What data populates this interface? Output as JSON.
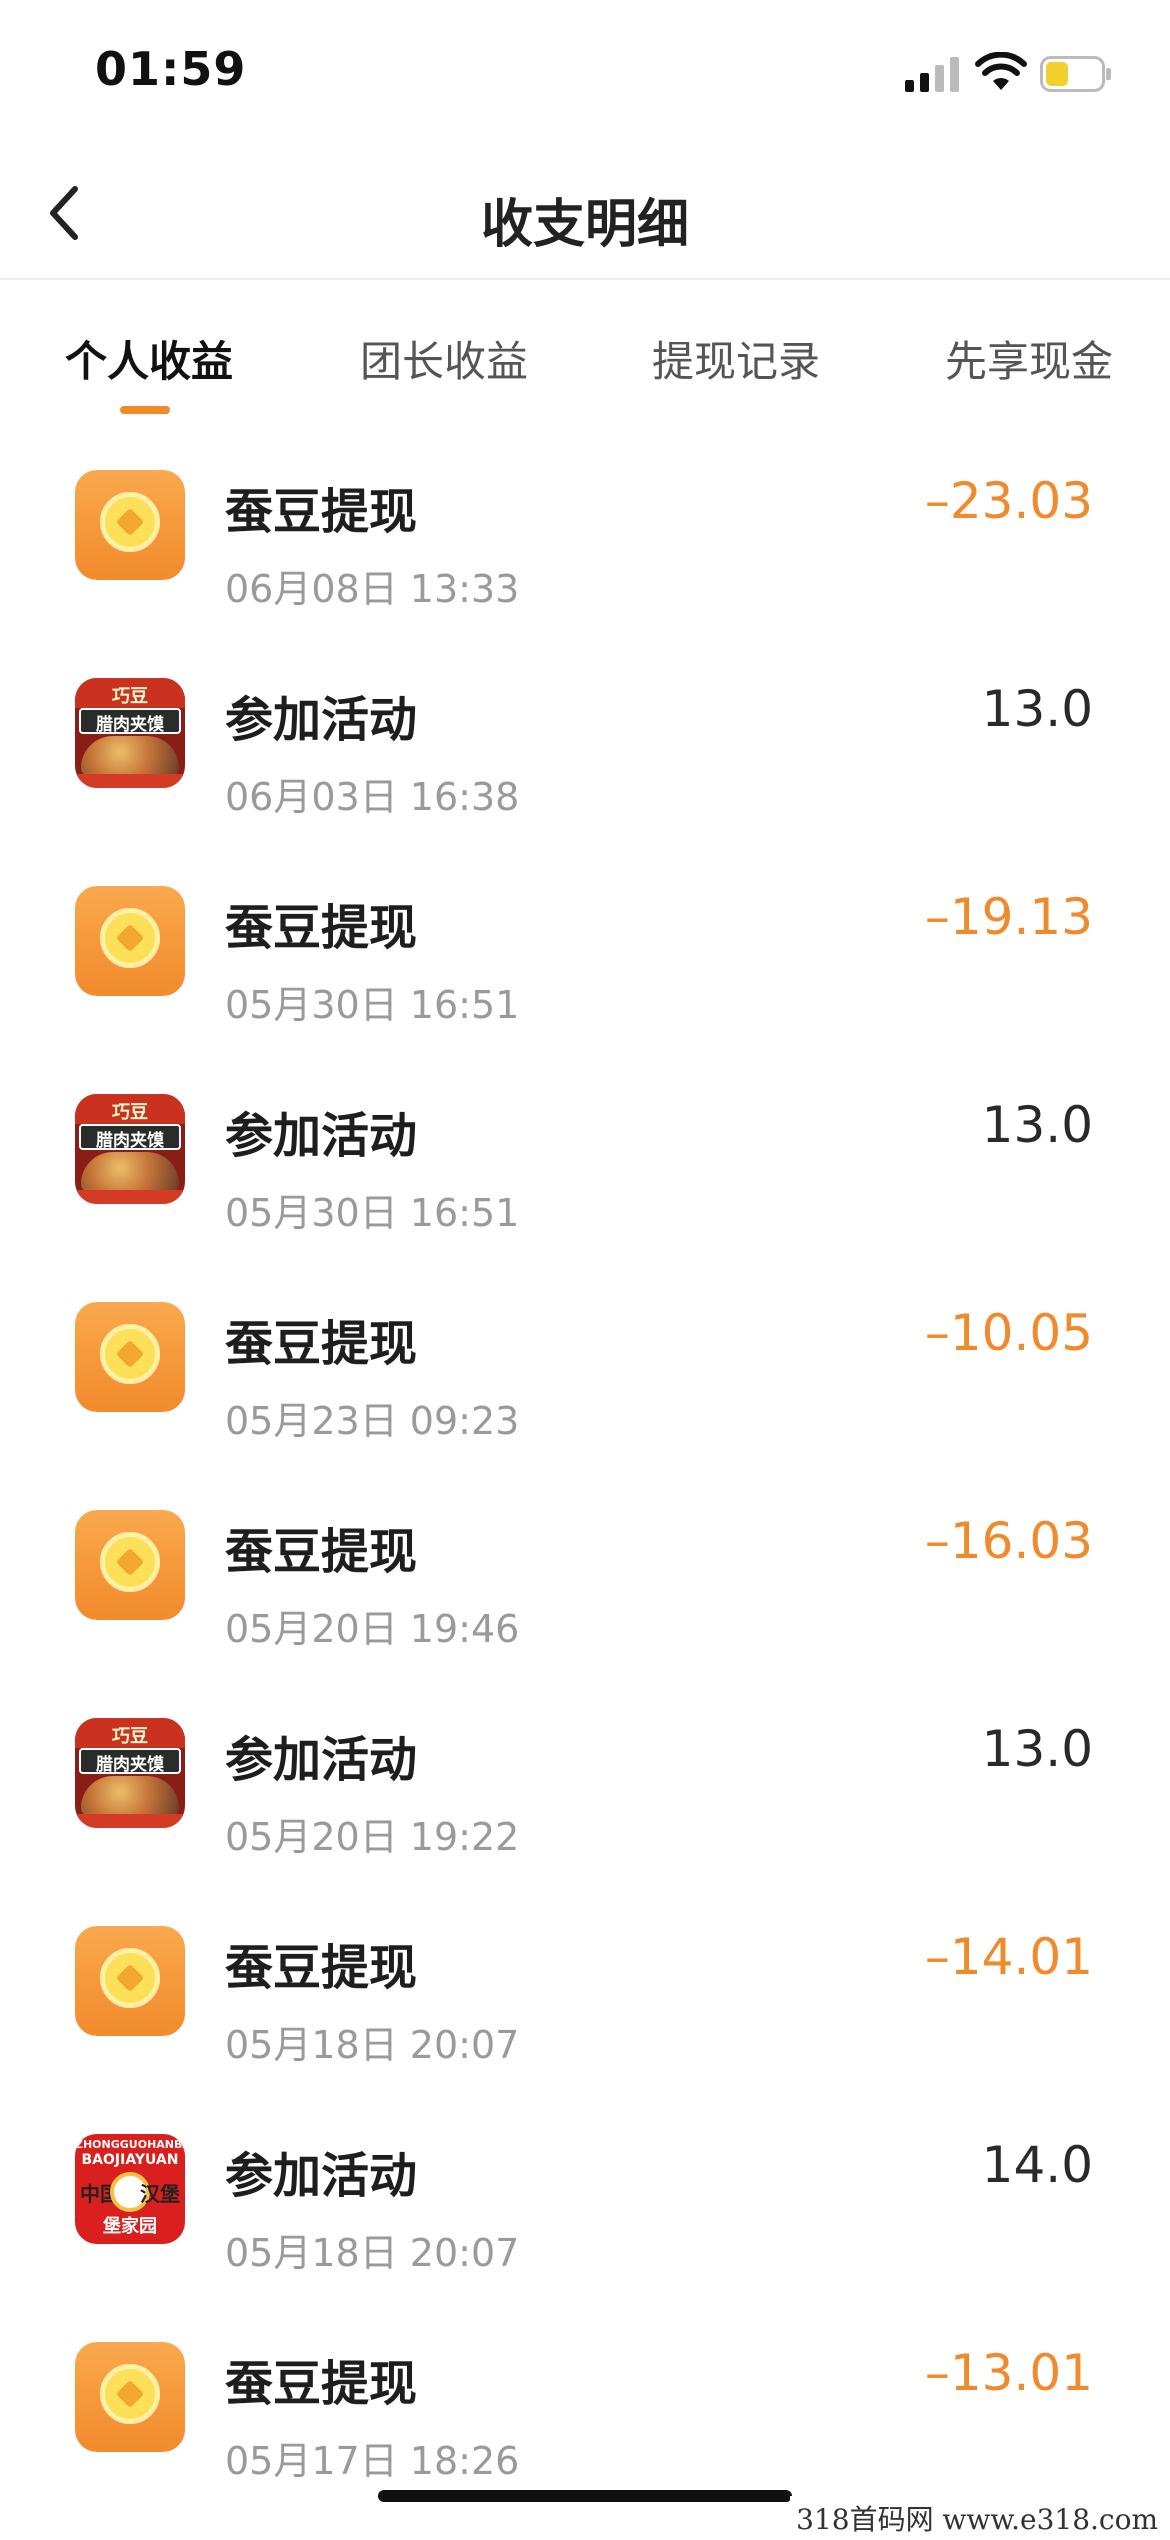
{
  "status_bar": {
    "time": "01:59"
  },
  "nav": {
    "title": "收支明细"
  },
  "tabs": [
    {
      "label": "个人收益",
      "active": true
    },
    {
      "label": "团长收益",
      "active": false
    },
    {
      "label": "提现记录",
      "active": false
    },
    {
      "label": "先享现金",
      "active": false
    }
  ],
  "colors": {
    "accent": "#f08a2a",
    "negative_amount": "#f08a2a",
    "positive_amount": "#2a2a2a"
  },
  "records": [
    {
      "icon": "coin-icon",
      "title": "蚕豆提现",
      "time": "06月08日 13:33",
      "amount": "–23.03",
      "negative": true
    },
    {
      "icon": "food-shop-icon",
      "title": "参加活动",
      "time": "06月03日 16:38",
      "amount": "13.0",
      "negative": false
    },
    {
      "icon": "coin-icon",
      "title": "蚕豆提现",
      "time": "05月30日 16:51",
      "amount": "–19.13",
      "negative": true
    },
    {
      "icon": "food-shop-icon",
      "title": "参加活动",
      "time": "05月30日 16:51",
      "amount": "13.0",
      "negative": false
    },
    {
      "icon": "coin-icon",
      "title": "蚕豆提现",
      "time": "05月23日 09:23",
      "amount": "–10.05",
      "negative": true
    },
    {
      "icon": "coin-icon",
      "title": "蚕豆提现",
      "time": "05月20日 19:46",
      "amount": "–16.03",
      "negative": true
    },
    {
      "icon": "food-shop-icon",
      "title": "参加活动",
      "time": "05月20日 19:22",
      "amount": "13.0",
      "negative": false
    },
    {
      "icon": "coin-icon",
      "title": "蚕豆提现",
      "time": "05月18日 20:07",
      "amount": "–14.01",
      "negative": true
    },
    {
      "icon": "burger-shop-icon",
      "title": "参加活动",
      "time": "05月18日 20:07",
      "amount": "14.0",
      "negative": false
    },
    {
      "icon": "coin-icon",
      "title": "蚕豆提现",
      "time": "05月17日 18:26",
      "amount": "–13.01",
      "negative": true
    }
  ],
  "icon_art": {
    "food_shop": {
      "brand": "巧豆",
      "dish": "腊肉夹馍"
    },
    "burger_shop": {
      "top": "ZHONGGUOHANBAO",
      "name": "BAOJIAYUAN",
      "left": "中国",
      "right": "汉堡",
      "bottom": "堡家园"
    }
  },
  "watermark": "318首码网  www.e318.com"
}
